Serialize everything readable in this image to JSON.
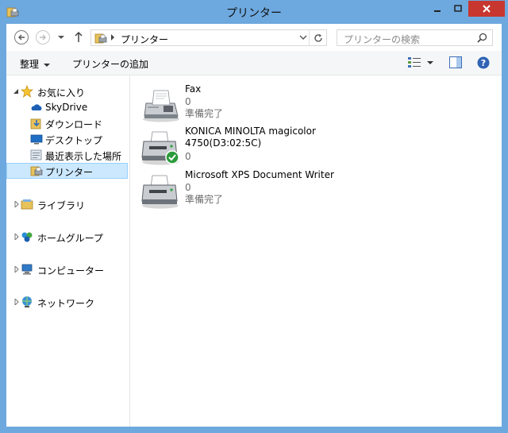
{
  "window": {
    "title": "プリンター"
  },
  "address": {
    "path_label": "プリンター"
  },
  "search": {
    "placeholder": "プリンターの検索"
  },
  "toolbar": {
    "organize_label": "整理",
    "add_printer_label": "プリンターの追加"
  },
  "nav": {
    "favorites": {
      "label": "お気に入り",
      "items": [
        {
          "label": "SkyDrive",
          "icon": "cloud-icon"
        },
        {
          "label": "ダウンロード",
          "icon": "download-folder-icon"
        },
        {
          "label": "デスクトップ",
          "icon": "desktop-icon"
        },
        {
          "label": "最近表示した場所",
          "icon": "recent-places-icon"
        },
        {
          "label": "プリンター",
          "icon": "printer-folder-icon",
          "selected": true
        }
      ]
    },
    "libraries": {
      "label": "ライブラリ"
    },
    "homegroup": {
      "label": "ホームグループ"
    },
    "computer": {
      "label": "コンピューター"
    },
    "network": {
      "label": "ネットワーク"
    }
  },
  "printers": [
    {
      "name": "Fax",
      "count": "0",
      "status": "準備完了",
      "is_default": false,
      "icon": "fax-icon"
    },
    {
      "name": "KONICA MINOLTA magicolor\n4750(D3:02:5C)",
      "count": "0",
      "status": "",
      "is_default": true,
      "icon": "printer-icon"
    },
    {
      "name": "Microsoft XPS Document Writer",
      "count": "0",
      "status": "準備完了",
      "is_default": false,
      "icon": "printer-icon"
    }
  ],
  "colors": {
    "frame": "#6da8de",
    "close_button": "#c7372f",
    "selection": "#cce8ff",
    "default_check": "#2b9a3b"
  }
}
